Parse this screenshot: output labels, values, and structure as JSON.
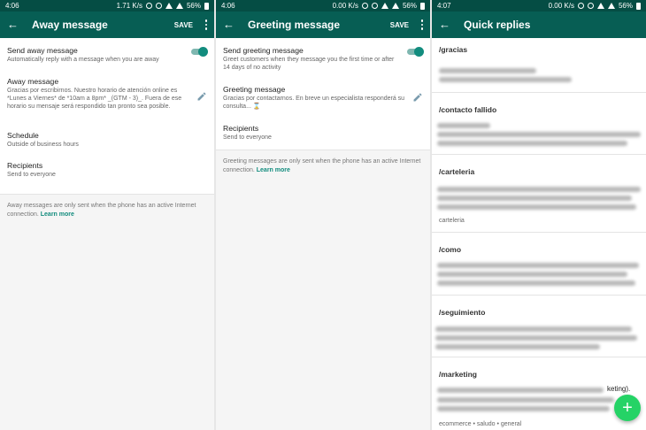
{
  "screens": [
    {
      "status": {
        "time": "4:06",
        "speed": "1.71 K/s",
        "battery": "56%"
      },
      "title": "Away message",
      "save_label": "SAVE",
      "toggle_item": {
        "label": "Send away message",
        "sub": "Automatically reply with a message when you are away",
        "on": true
      },
      "message": {
        "label": "Away message",
        "text": "Gracias por escribirnos. Nuestro horario de atención online es *Lunes a Viernes* de *10am a 8pm* _(GTM - 3)_. Fuera de ese horario su mensaje será respondido tan pronto sea posible."
      },
      "schedule": {
        "label": "Schedule",
        "sub": "Outside of business hours"
      },
      "recipients": {
        "label": "Recipients",
        "sub": "Send to everyone"
      },
      "footer_note": "Away messages are only sent when the phone has an active Internet connection.",
      "learn_more": "Learn more"
    },
    {
      "status": {
        "time": "4:06",
        "speed": "0.00 K/s",
        "battery": "56%"
      },
      "title": "Greeting message",
      "save_label": "SAVE",
      "toggle_item": {
        "label": "Send greeting message",
        "sub": "Greet customers when they message you the first time or after 14 days of no activity",
        "on": true
      },
      "message": {
        "label": "Greeting message",
        "text": "Gracias por contactarnos. En breve un especialista responderá su consulta... ⌛"
      },
      "recipients": {
        "label": "Recipients",
        "sub": "Send to everyone"
      },
      "footer_note": "Greeting messages are only sent when the phone has an active Internet connection.",
      "learn_more": "Learn more"
    },
    {
      "status": {
        "time": "4:07",
        "speed": "0.00 K/s",
        "battery": "56%"
      },
      "title": "Quick replies",
      "replies": [
        {
          "shortcut": "/gracias",
          "keywords": ""
        },
        {
          "shortcut": "/contacto fallido",
          "keywords": ""
        },
        {
          "shortcut": "/carteleria",
          "keywords": "carteleria"
        },
        {
          "shortcut": "/como",
          "keywords": ""
        },
        {
          "shortcut": "/seguimiento",
          "keywords": ""
        },
        {
          "shortcut": "/marketing",
          "keywords": "ecommerce • saludo • general",
          "visible_fragment": "keting)."
        }
      ],
      "fab_icon": "+"
    }
  ],
  "colors": {
    "status_bar": "#054d44",
    "app_bar": "#075e54",
    "accent": "#128c7e",
    "fab": "#25d366"
  },
  "icons": [
    "back-arrow-icon",
    "more-vert-icon",
    "pencil-icon",
    "toggle-switch",
    "add-icon",
    "wifi-icon",
    "signal-icon",
    "battery-icon",
    "alarm-icon",
    "vibrate-icon"
  ]
}
